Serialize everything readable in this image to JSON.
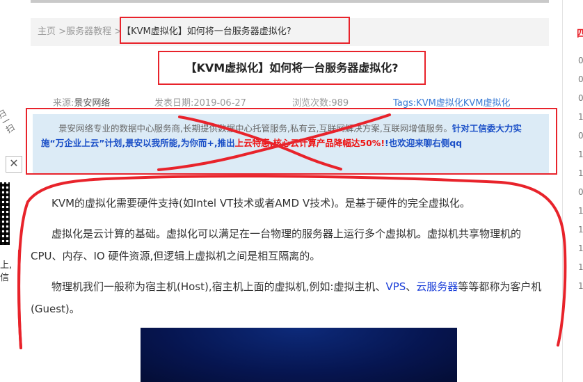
{
  "breadcrumb": {
    "home": "主页",
    "sep": ">",
    "section": "服务器教程",
    "current": "【KVM虚拟化】如何将一台服务器虚拟化?"
  },
  "article": {
    "title": "【KVM虚拟化】如何将一台服务器虚拟化?",
    "meta": {
      "source_label": "来源:",
      "source": "景安网络",
      "date_label": "发表日期:",
      "date": "2019-06-27",
      "views_label": "浏览次数:",
      "views": "989",
      "tags_label": "Tags:",
      "tags": "KVM虚拟化KVM虚拟化"
    },
    "intro": {
      "normal": "景安网络专业的数据中心服务商,长期提供数据中心托管服务,私有云,互联网解决方案,互联网增值服务。",
      "blue1": "针对工信委大力实施“万企业上云”计划,景安以我所能,为你而+,推出",
      "red": "上云特惠,核心云计算产品降幅达50%!",
      "blue2": "!也欢迎来聊右侧qq"
    },
    "p1": "KVM的虚拟化需要硬件支持(如Intel VT技术或者AMD V技术)。是基于硬件的完全虚拟化。",
    "p2": "虚拟化是云计算的基础。虚拟化可以满足在一台物理的服务器上运行多个虚拟机。虚拟机共享物理机的CPU、内存、IO 硬件资源,但逻辑上虚拟机之间是相互隔离的。",
    "p3_a": "物理机我们一般称为宿主机(Host),宿主机上面的虚拟机,例如:虚拟主机、",
    "p3_link1": "VPS",
    "p3_b": "、",
    "p3_link2": "云服务器",
    "p3_c": "等等都称为客户机(Guest)。"
  },
  "left_widget": {
    "scan_text": "扫一扫",
    "close": "✕",
    "side_line1": "上,",
    "side_line2": "信"
  },
  "right_sidebar": {
    "head": "四",
    "numbers": [
      "0",
      "0",
      "0",
      "1",
      "0",
      "1",
      "1",
      "0",
      "1",
      "1",
      "1",
      "1",
      "1"
    ]
  },
  "colors": {
    "annotation_red": "#e8232b",
    "link_blue": "#1a3ed8",
    "intro_bg": "#dcebf6"
  }
}
